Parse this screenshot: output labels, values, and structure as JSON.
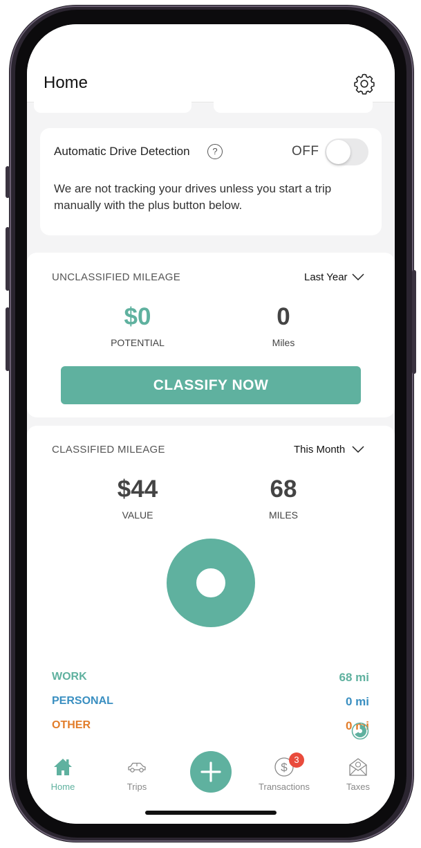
{
  "header": {
    "title": "Home"
  },
  "drive_detection": {
    "title": "Automatic Drive Detection",
    "help": "?",
    "toggle_label": "OFF",
    "enabled": false,
    "description": "We are not tracking your drives unless you start a trip manually with the plus button below."
  },
  "unclassified": {
    "label": "UNCLASSIFIED MILEAGE",
    "period": "Last Year",
    "potential_value": "$0",
    "potential_label": "POTENTIAL",
    "miles_value": "0",
    "miles_label": "Miles",
    "button_label": "CLASSIFY NOW"
  },
  "classified": {
    "label": "CLASSIFIED MILEAGE",
    "period": "This Month",
    "value": "$44",
    "value_label": "VALUE",
    "miles": "68",
    "miles_label": "MILES",
    "categories": [
      {
        "name": "WORK",
        "value": "68 mi",
        "color": "#5fb19f"
      },
      {
        "name": "PERSONAL",
        "value": "0 mi",
        "color": "#3a8fc1"
      },
      {
        "name": "OTHER",
        "value": "0 mi",
        "color": "#e27d2a"
      }
    ]
  },
  "tabbar": {
    "tabs": [
      {
        "label": "Home",
        "icon": "home-icon"
      },
      {
        "label": "Trips",
        "icon": "car-icon"
      },
      {
        "label": "Transactions",
        "icon": "dollar-icon"
      },
      {
        "label": "Taxes",
        "icon": "envelope-icon"
      }
    ],
    "transactions_badge": "3"
  },
  "colors": {
    "accent": "#5fb19f",
    "badge": "#e94b3c"
  }
}
